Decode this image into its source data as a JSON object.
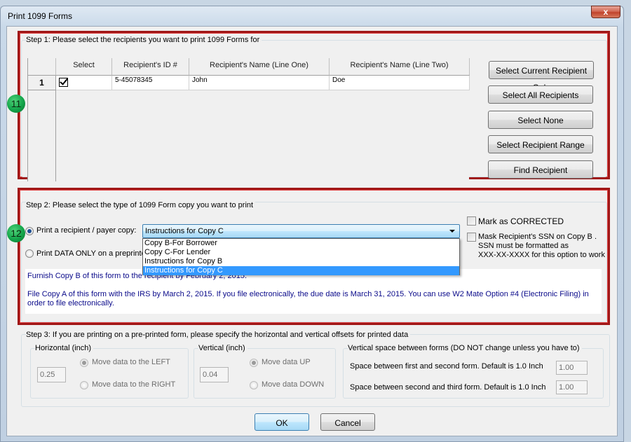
{
  "window": {
    "title": "Print 1099 Forms",
    "close_label": "x"
  },
  "step1": {
    "title": "Step 1: Please select the recipients you want to print 1099 Forms for",
    "badge": "11",
    "columns": [
      "Select",
      "Recipient's ID #",
      "Recipient's Name (Line One)",
      "Recipient's Name (Line Two)"
    ],
    "rows": [
      {
        "num": "1",
        "selected": true,
        "id": "5-45078345",
        "name1": "John",
        "name2": "Doe"
      }
    ],
    "buttons": {
      "current": "Select Current Recipient Only",
      "all": "Select All Recipients",
      "none": "Select None",
      "range": "Select Recipient Range",
      "find": "Find Recipient"
    }
  },
  "step2": {
    "title": "Step 2: Please select the type of 1099 Form copy you want to print",
    "badge": "12",
    "radio_copy_label": "Print a recipient / payer copy:",
    "radio_data_label": "Print DATA ONLY on a preprinted form",
    "selected_mode": "copy",
    "copy_select": {
      "value": "Instructions for Copy C",
      "options": [
        "Copy B-For Borrower",
        "Copy C-For Lender",
        "Instructions for Copy B",
        "Instructions for Copy C"
      ],
      "highlighted": "Instructions for Copy C"
    },
    "mark_corrected_label": "Mark as CORRECTED",
    "mark_corrected": false,
    "mask_ssn_label_1": "Mask Recipient's SSN on Copy B .",
    "mask_ssn_label_2": "SSN must be formatted as",
    "mask_ssn_label_3": "XXX-XX-XXXX for this option to work",
    "mask_ssn": false,
    "info_line1": "Furnish Copy B of this form to the recipient by February 2, 2015.",
    "info_line2": "File Copy A of this form with the IRS by March 2, 2015. If you file electronically, the due date is March 31, 2015. You can use W2 Mate Option #4 (Electronic Filing) in order to file electronically."
  },
  "step3": {
    "title": "Step 3: If you are printing on a pre-printed form, please specify the horizontal and vertical offsets for printed data",
    "horizontal": {
      "title": "Horizontal (inch)",
      "value": "0.25",
      "left_label": "Move data to the LEFT",
      "right_label": "Move data to the RIGHT",
      "selected": "left"
    },
    "vertical": {
      "title": "Vertical (inch)",
      "value": "0.04",
      "up_label": "Move data UP",
      "down_label": "Move data DOWN",
      "selected": "up"
    },
    "spacing": {
      "title": "Vertical space between forms (DO NOT change unless you have to)",
      "first_label": "Space between first and second form. Default is 1.0 Inch",
      "first_value": "1.00",
      "second_label": "Space between second and third form. Default is 1.0 Inch",
      "second_value": "1.00"
    }
  },
  "footer": {
    "ok": "OK",
    "cancel": "Cancel"
  }
}
